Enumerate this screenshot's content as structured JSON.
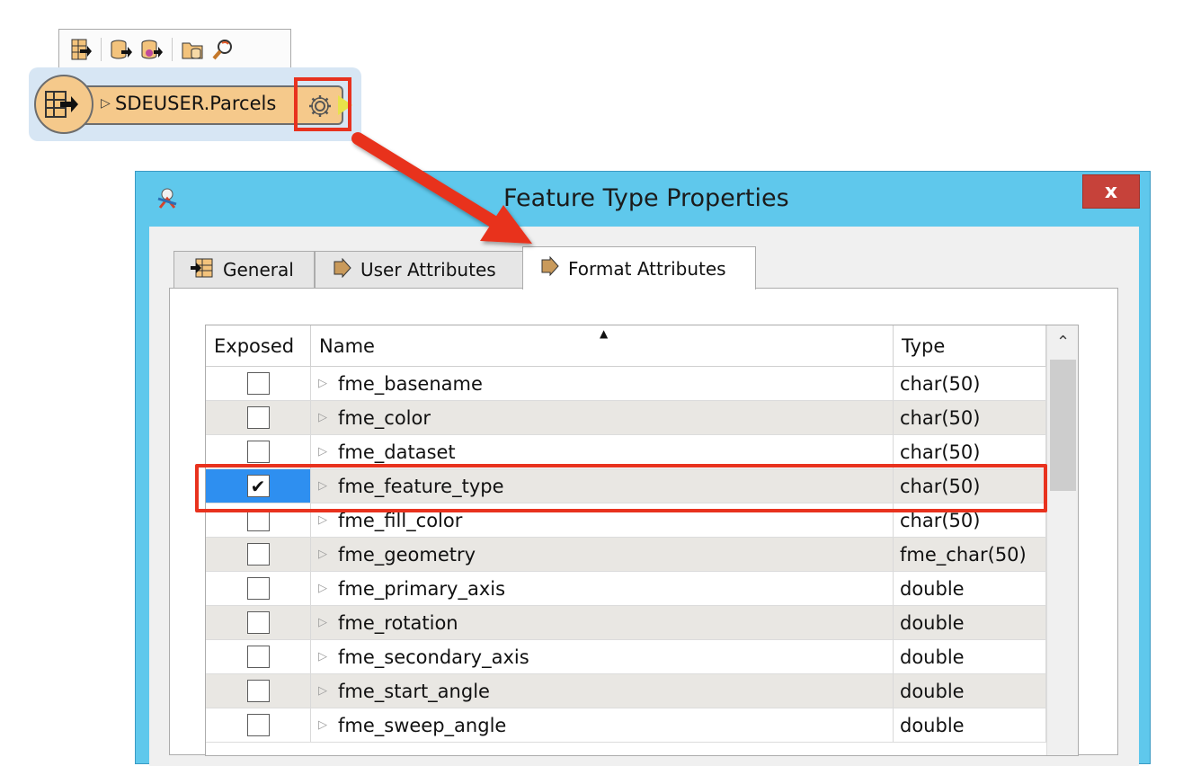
{
  "workspace": {
    "toolbar_icons": [
      "reader-feature-type-icon",
      "add-writer-icon",
      "add-dynamic-writer-icon",
      "open-folder-icon",
      "inspector-icon"
    ],
    "feature_type_label": "SDEUSER.Parcels"
  },
  "dialog": {
    "title": "Feature Type Properties",
    "close_label": "x",
    "tabs": [
      {
        "label": "General",
        "icon": "general-table-icon",
        "active": false
      },
      {
        "label": "User Attributes",
        "icon": "attribute-arrow-icon",
        "active": false
      },
      {
        "label": "Format Attributes",
        "icon": "attribute-arrow-icon",
        "active": true
      }
    ],
    "grid": {
      "columns": [
        "Exposed",
        "Name",
        "Type"
      ],
      "sort_column": "Name",
      "rows": [
        {
          "exposed": false,
          "name": "fme_basename",
          "type": "char(50)"
        },
        {
          "exposed": false,
          "name": "fme_color",
          "type": "char(50)"
        },
        {
          "exposed": false,
          "name": "fme_dataset",
          "type": "char(50)"
        },
        {
          "exposed": true,
          "name": "fme_feature_type",
          "type": "char(50)"
        },
        {
          "exposed": false,
          "name": "fme_fill_color",
          "type": "char(50)"
        },
        {
          "exposed": false,
          "name": "fme_geometry",
          "type": "fme_char(50)"
        },
        {
          "exposed": false,
          "name": "fme_primary_axis",
          "type": "double"
        },
        {
          "exposed": false,
          "name": "fme_rotation",
          "type": "double"
        },
        {
          "exposed": false,
          "name": "fme_secondary_axis",
          "type": "double"
        },
        {
          "exposed": false,
          "name": "fme_start_angle",
          "type": "double"
        },
        {
          "exposed": false,
          "name": "fme_sweep_angle",
          "type": "double"
        }
      ]
    }
  },
  "colors": {
    "highlight": "#e8321e",
    "dialog_frame": "#5fc8ec",
    "node_fill": "#f5c98b",
    "selection": "#2e8ff0"
  }
}
